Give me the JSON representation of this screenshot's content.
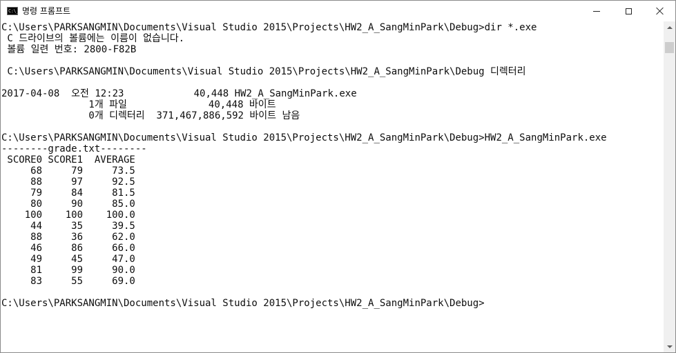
{
  "window": {
    "title": "명령 프롬프트",
    "app_icon_text": "C:\\_",
    "controls": {
      "minimize": "minimize-icon",
      "maximize": "maximize-icon",
      "close": "close-icon"
    }
  },
  "console": {
    "lines": [
      "C:\\Users\\PARKSANGMIN\\Documents\\Visual Studio 2015\\Projects\\HW2_A_SangMinPark\\Debug>dir *.exe",
      " C 드라이브의 볼륨에는 이름이 없습니다.",
      " 볼륨 일련 번호: 2800-F82B",
      "",
      " C:\\Users\\PARKSANGMIN\\Documents\\Visual Studio 2015\\Projects\\HW2_A_SangMinPark\\Debug 디렉터리",
      "",
      "2017-04-08  오전 12:23            40,448 HW2_A_SangMinPark.exe",
      "               1개 파일              40,448 바이트",
      "               0개 디렉터리  371,467,886,592 바이트 남음",
      "",
      "C:\\Users\\PARKSANGMIN\\Documents\\Visual Studio 2015\\Projects\\HW2_A_SangMinPark\\Debug>HW2_A_SangMinPark.exe",
      "--------grade.txt--------",
      " SCORE0 SCORE1  AVERAGE",
      "     68     79     73.5",
      "     88     97     92.5",
      "     79     84     81.5",
      "     80     90     85.0",
      "    100    100    100.0",
      "     44     35     39.5",
      "     88     36     62.0",
      "     46     86     66.0",
      "     49     45     47.0",
      "     81     99     90.0",
      "     83     55     69.0",
      "",
      "C:\\Users\\PARKSANGMIN\\Documents\\Visual Studio 2015\\Projects\\HW2_A_SangMinPark\\Debug>"
    ]
  },
  "colors": {
    "background": "#ffffff",
    "text": "#0c0c0c",
    "scrollbar": "#f0f0f0",
    "scroll_thumb": "#cdcdcd"
  }
}
